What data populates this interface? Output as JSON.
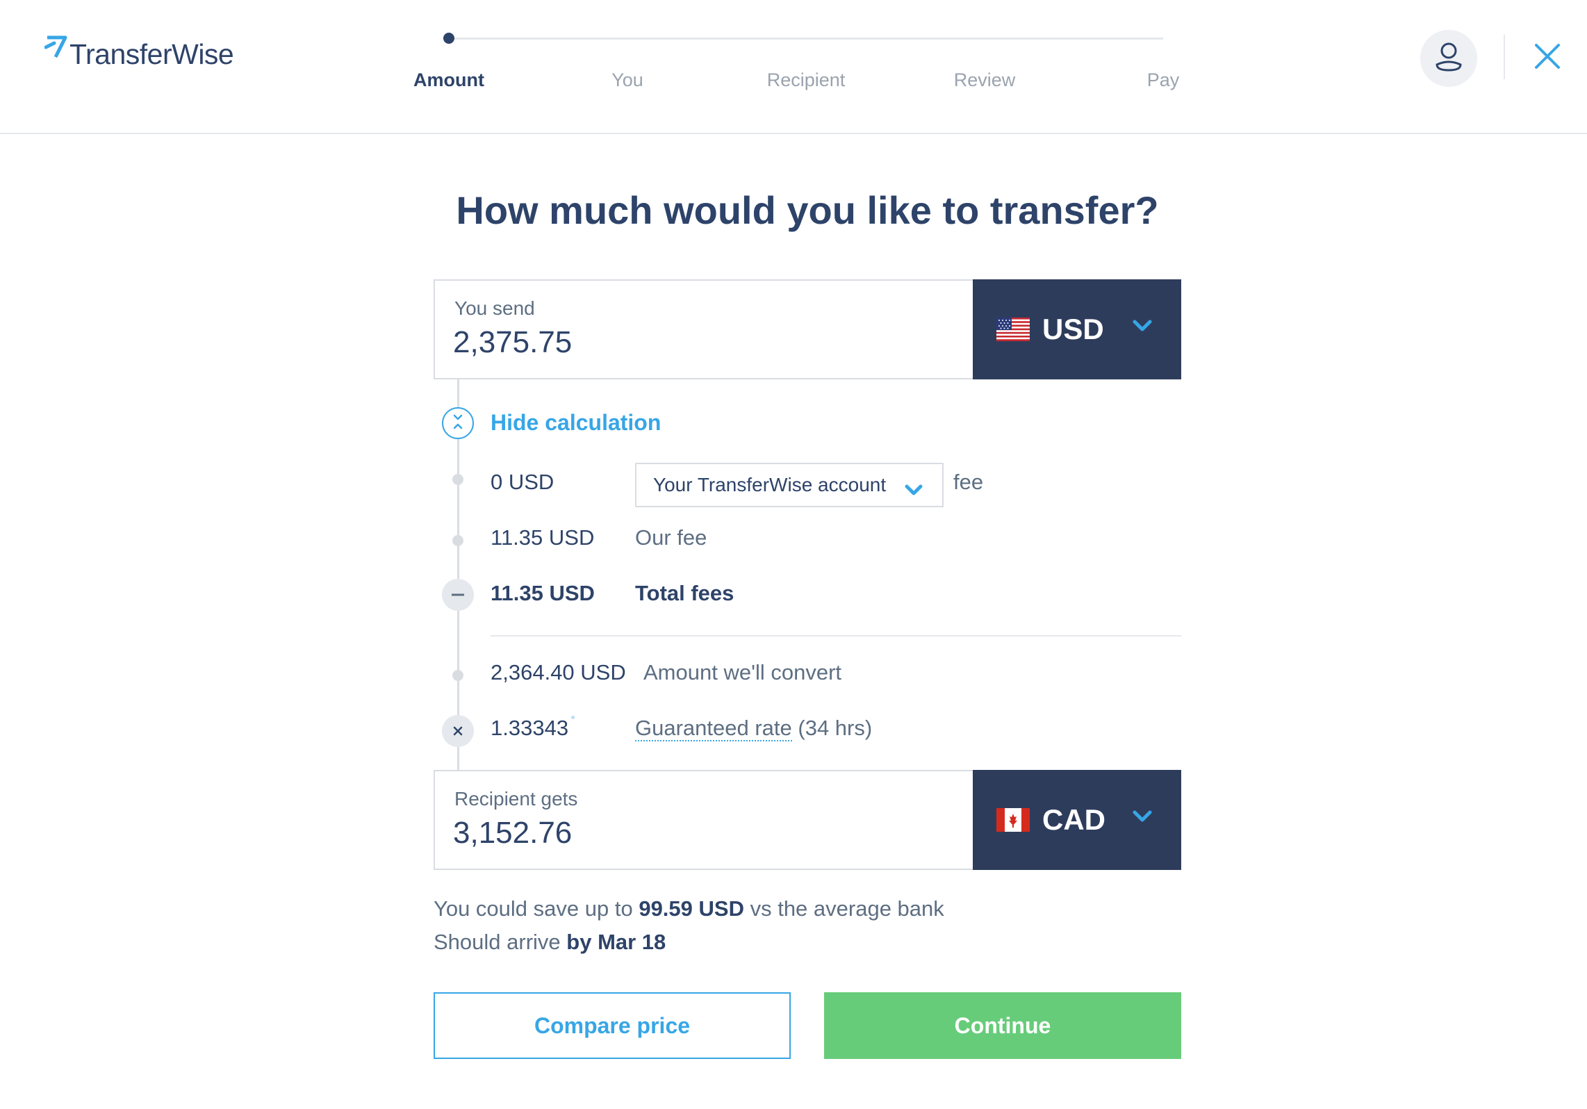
{
  "header": {
    "logo_mark": "⁷7",
    "logo_text": "TransferWise",
    "steps": [
      {
        "label": "Amount",
        "active": true
      },
      {
        "label": "You",
        "active": false
      },
      {
        "label": "Recipient",
        "active": false
      },
      {
        "label": "Review",
        "active": false
      },
      {
        "label": "Pay",
        "active": false
      }
    ],
    "icons": {
      "account": "user-icon",
      "close": "close-icon"
    }
  },
  "main": {
    "title": "How much would you like to transfer?",
    "send": {
      "label": "You send",
      "value": "2,375.75",
      "currency": "USD",
      "flag": "us-flag-icon"
    },
    "calculation": {
      "toggle_label": "Hide calculation",
      "payment_fee_amount": "0 USD",
      "payment_method": "Your TransferWise account",
      "payment_fee_suffix": "fee",
      "our_fee_amount": "11.35 USD",
      "our_fee_label": "Our fee",
      "total_fees_amount": "11.35 USD",
      "total_fees_label": "Total fees",
      "convert_amount": "2,364.40 USD",
      "convert_label": "Amount we'll convert",
      "rate": "1.33343",
      "rate_label": "Guaranteed rate",
      "rate_duration": "(34 hrs)"
    },
    "receive": {
      "label": "Recipient gets",
      "value": "3,152.76",
      "currency": "CAD",
      "flag": "ca-flag-icon"
    },
    "savings": {
      "prefix": "You could save up to",
      "amount": "99.59 USD",
      "suffix": "vs the average bank",
      "arrive_prefix": "Should arrive",
      "arrive_date": "by Mar 18"
    },
    "buttons": {
      "compare": "Compare price",
      "continue": "Continue"
    }
  },
  "colors": {
    "navy": "#2e4369",
    "currency_bg": "#2e3c5c",
    "accent_blue": "#37a6e6",
    "continue_green": "#67cc7a"
  }
}
